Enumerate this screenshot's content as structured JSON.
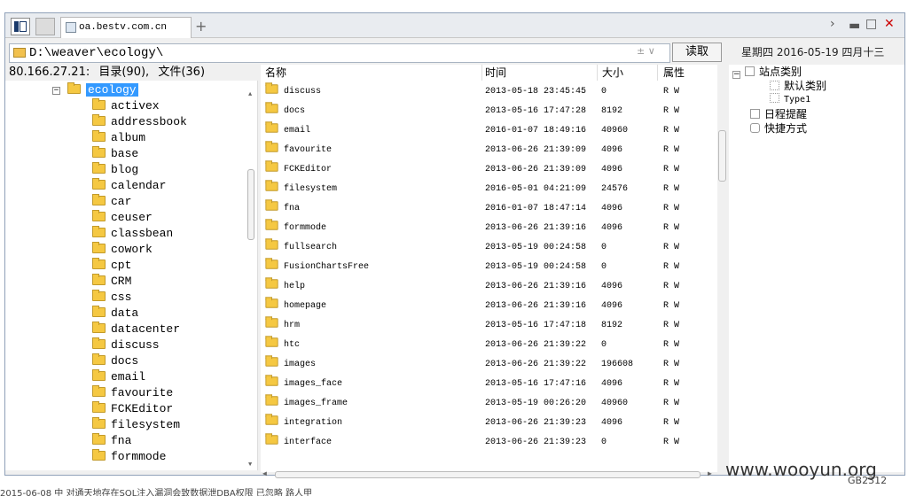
{
  "tab": {
    "title": "oa.bestv.com.cn"
  },
  "path": "D:\\weaver\\ecology\\",
  "controls": {
    "read": "读取",
    "drop": "± ∨"
  },
  "datebar": {
    "weekday": "星期四",
    "date": "2016-05-19",
    "lunar": "四月十三"
  },
  "status": {
    "ip": "80.166.27.21:",
    "dirs": "目录(90),",
    "files": "文件(36)"
  },
  "tree": {
    "root": "ecology",
    "children": [
      "activex",
      "addressbook",
      "album",
      "base",
      "blog",
      "calendar",
      "car",
      "ceuser",
      "classbean",
      "cowork",
      "cpt",
      "CRM",
      "css",
      "data",
      "datacenter",
      "discuss",
      "docs",
      "email",
      "favourite",
      "FCKEditor",
      "filesystem",
      "fna",
      "formmode"
    ]
  },
  "columns": {
    "name": "名称",
    "time": "时间",
    "size": "大小",
    "attr": "属性"
  },
  "files": [
    {
      "name": "discuss",
      "time": "2013-05-18 23:45:45",
      "size": "0",
      "attr": "R W"
    },
    {
      "name": "docs",
      "time": "2013-05-16 17:47:28",
      "size": "8192",
      "attr": "R W"
    },
    {
      "name": "email",
      "time": "2016-01-07 18:49:16",
      "size": "40960",
      "attr": "R W"
    },
    {
      "name": "favourite",
      "time": "2013-06-26 21:39:09",
      "size": "4096",
      "attr": "R W"
    },
    {
      "name": "FCKEditor",
      "time": "2013-06-26 21:39:09",
      "size": "4096",
      "attr": "R W"
    },
    {
      "name": "filesystem",
      "time": "2016-05-01 04:21:09",
      "size": "24576",
      "attr": "R W"
    },
    {
      "name": "fna",
      "time": "2016-01-07 18:47:14",
      "size": "4096",
      "attr": "R W"
    },
    {
      "name": "formmode",
      "time": "2013-06-26 21:39:16",
      "size": "4096",
      "attr": "R W"
    },
    {
      "name": "fullsearch",
      "time": "2013-05-19 00:24:58",
      "size": "0",
      "attr": "R W"
    },
    {
      "name": "FusionChartsFree",
      "time": "2013-05-19 00:24:58",
      "size": "0",
      "attr": "R W"
    },
    {
      "name": "help",
      "time": "2013-06-26 21:39:16",
      "size": "4096",
      "attr": "R W"
    },
    {
      "name": "homepage",
      "time": "2013-06-26 21:39:16",
      "size": "4096",
      "attr": "R W"
    },
    {
      "name": "hrm",
      "time": "2013-05-16 17:47:18",
      "size": "8192",
      "attr": "R W"
    },
    {
      "name": "htc",
      "time": "2013-06-26 21:39:22",
      "size": "0",
      "attr": "R W"
    },
    {
      "name": "images",
      "time": "2013-06-26 21:39:22",
      "size": "196608",
      "attr": "R W"
    },
    {
      "name": "images_face",
      "time": "2013-05-16 17:47:16",
      "size": "4096",
      "attr": "R W"
    },
    {
      "name": "images_frame",
      "time": "2013-05-19 00:26:20",
      "size": "40960",
      "attr": "R W"
    },
    {
      "name": "integration",
      "time": "2013-06-26 21:39:23",
      "size": "4096",
      "attr": "R W"
    },
    {
      "name": "interface",
      "time": "2013-06-26 21:39:23",
      "size": "0",
      "attr": "R W"
    }
  ],
  "side": {
    "sites": "站点类别",
    "default": "默认类别",
    "type1": "Type1",
    "reminder": "日程提醒",
    "shortcut": "快捷方式"
  },
  "watermark": "www.wooyun.org",
  "encoding": "GB2312",
  "bottom": "2015-06-08    中 对通天地存在SQL注入漏洞会致数据泄DBA权限                                                                                    已忽略                    路人甲"
}
